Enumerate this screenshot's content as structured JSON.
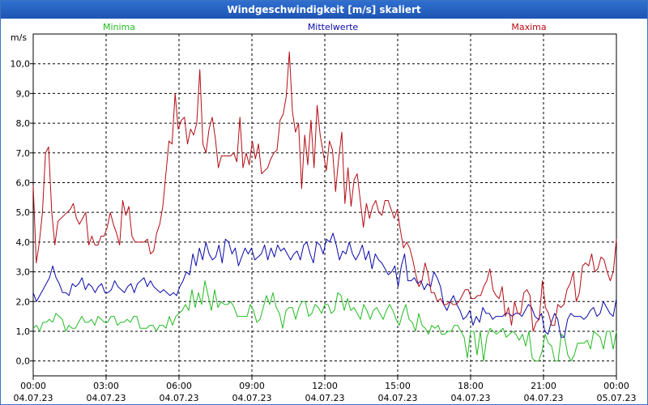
{
  "window": {
    "title": "Windgeschwindigkeit [m/s] skaliert"
  },
  "chart_data": {
    "type": "line",
    "title": "Windgeschwindigkeit [m/s] skaliert",
    "ylabel": "m/s",
    "xlabel": "",
    "ylim": [
      -0.5,
      11.0
    ],
    "xlim": [
      0,
      24
    ],
    "y_ticks": [
      0.0,
      1.0,
      2.0,
      3.0,
      4.0,
      5.0,
      6.0,
      7.0,
      8.0,
      9.0,
      10.0
    ],
    "y_tick_labels": [
      "0,0",
      "1,0",
      "2,0",
      "3,0",
      "4,0",
      "5,0",
      "6,0",
      "7,0",
      "8,0",
      "9,0",
      "10,0"
    ],
    "x_ticks": [
      {
        "x": 0,
        "time": "00:00",
        "date": "04.07.23"
      },
      {
        "x": 3,
        "time": "03:00",
        "date": "04.07.23"
      },
      {
        "x": 6,
        "time": "06:00",
        "date": "04.07.23"
      },
      {
        "x": 9,
        "time": "09:00",
        "date": "04.07.23"
      },
      {
        "x": 12,
        "time": "12:00",
        "date": "04.07.23"
      },
      {
        "x": 15,
        "time": "15:00",
        "date": "04.07.23"
      },
      {
        "x": 18,
        "time": "18:00",
        "date": "04.07.23"
      },
      {
        "x": 21,
        "time": "21:00",
        "date": "04.07.23"
      },
      {
        "x": 24,
        "time": "00:00",
        "date": "05.07.23"
      }
    ],
    "grid": true,
    "legend_position": "top",
    "x_step_hours": 0.16667,
    "series": [
      {
        "name": "Minima",
        "color": "#22bb22",
        "values": [
          1.1,
          1.2,
          1.0,
          1.3,
          1.3,
          1.4,
          1.3,
          1.6,
          1.5,
          1.4,
          1.0,
          1.2,
          1.1,
          1.1,
          1.3,
          1.5,
          1.3,
          1.3,
          1.4,
          1.2,
          1.5,
          1.4,
          1.3,
          1.3,
          1.5,
          1.5,
          1.2,
          1.3,
          1.3,
          1.4,
          1.3,
          1.5,
          1.5,
          1.1,
          1.1,
          1.1,
          1.2,
          1.2,
          1.0,
          1.2,
          1.2,
          1.1,
          1.5,
          1.2,
          1.5,
          1.6,
          1.7,
          1.9,
          1.7,
          2.4,
          1.8,
          2.3,
          1.9,
          2.7,
          2.2,
          1.7,
          2.4,
          1.8,
          2.0,
          1.9,
          1.9,
          2.0,
          1.8,
          1.5,
          1.5,
          1.5,
          1.5,
          1.9,
          1.7,
          1.3,
          1.4,
          1.8,
          2.2,
          1.9,
          2.3,
          1.8,
          1.6,
          1.1,
          1.7,
          1.8,
          1.8,
          1.4,
          1.8,
          2.0,
          2.0,
          1.5,
          1.6,
          1.9,
          1.8,
          1.6,
          1.9,
          1.9,
          1.6,
          1.7,
          2.3,
          2.2,
          1.7,
          2.1,
          1.7,
          1.8,
          1.6,
          1.4,
          1.9,
          1.7,
          1.4,
          1.7,
          1.8,
          1.6,
          1.4,
          1.7,
          1.9,
          1.7,
          1.4,
          1.2,
          1.6,
          1.9,
          1.4,
          1.3,
          1.0,
          1.6,
          1.2,
          1.1,
          0.9,
          1.2,
          1.1,
          1.2,
          0.9,
          0.9,
          1.0,
          1.0,
          1.2,
          1.2,
          1.0,
          0.8,
          0.1,
          1.0,
          1.0,
          0.2,
          1.0,
          0.0,
          0.8,
          1.1,
          1.0,
          0.9,
          1.0,
          1.1,
          0.8,
          0.9,
          1.0,
          0.9,
          0.7,
          0.9,
          0.5,
          1.0,
          0.1,
          0.0,
          0.0,
          0.3,
          0.9,
          0.6,
          0.5,
          0.0,
          0.0,
          0.9,
          0.8,
          0.2,
          0.0,
          0.2,
          0.6,
          0.6,
          0.6,
          0.7,
          0.4,
          1.0,
          0.9,
          0.8,
          0.4,
          1.0,
          1.0,
          0.4,
          1.0
        ]
      },
      {
        "name": "Mittelwerte",
        "color": "#0a0aaa",
        "values": [
          2.3,
          2.0,
          2.2,
          2.4,
          2.6,
          2.8,
          3.2,
          2.8,
          2.6,
          2.3,
          2.3,
          2.2,
          2.6,
          2.5,
          2.6,
          2.8,
          2.4,
          2.6,
          2.5,
          2.3,
          2.5,
          2.6,
          2.3,
          2.3,
          2.4,
          2.7,
          2.5,
          2.4,
          2.3,
          2.5,
          2.6,
          2.3,
          2.6,
          2.7,
          2.8,
          2.5,
          2.7,
          2.5,
          2.4,
          2.3,
          2.4,
          2.3,
          2.2,
          2.3,
          2.2,
          2.5,
          2.7,
          3.0,
          2.9,
          3.6,
          3.2,
          3.8,
          3.4,
          4.0,
          3.6,
          3.4,
          3.5,
          3.9,
          3.3,
          4.1,
          4.0,
          3.6,
          3.8,
          3.2,
          3.5,
          3.8,
          3.6,
          3.8,
          3.4,
          3.5,
          3.6,
          3.9,
          3.4,
          3.8,
          3.5,
          3.9,
          3.7,
          3.8,
          3.6,
          3.4,
          3.6,
          3.7,
          3.4,
          3.9,
          4.0,
          3.6,
          3.3,
          4.0,
          3.9,
          3.6,
          4.1,
          4.0,
          4.3,
          3.9,
          3.4,
          3.7,
          3.6,
          4.0,
          3.6,
          3.4,
          3.6,
          3.9,
          3.4,
          3.7,
          3.1,
          3.6,
          3.4,
          3.3,
          3.1,
          2.9,
          3.0,
          3.2,
          2.5,
          3.2,
          3.6,
          2.7,
          2.7,
          2.8,
          2.6,
          2.7,
          2.4,
          2.6,
          2.5,
          3.0,
          2.8,
          2.5,
          1.9,
          1.7,
          2.0,
          2.2,
          1.9,
          1.7,
          1.4,
          1.5,
          1.7,
          1.2,
          1.5,
          1.3,
          1.8,
          1.6,
          1.6,
          1.4,
          1.5,
          1.5,
          1.5,
          1.6,
          1.6,
          1.5,
          1.6,
          1.6,
          1.5,
          1.7,
          1.9,
          1.8,
          1.5,
          1.4,
          1.6,
          1.0,
          0.9,
          1.3,
          1.6,
          1.4,
          0.8,
          0.8,
          1.4,
          1.6,
          1.5,
          1.5,
          1.5,
          1.4,
          1.5,
          1.7,
          1.8,
          1.5,
          1.6,
          2.0,
          1.8,
          1.6,
          1.5,
          2.1
        ]
      },
      {
        "name": "Maxima",
        "color": "#b40c14",
        "values": [
          5.9,
          3.3,
          4.0,
          5.0,
          7.0,
          7.2,
          5.0,
          3.9,
          4.7,
          4.8,
          4.9,
          5.0,
          5.1,
          5.3,
          4.8,
          4.6,
          4.8,
          5.0,
          3.9,
          4.2,
          3.9,
          3.9,
          4.2,
          4.2,
          4.5,
          5.0,
          4.6,
          4.3,
          3.9,
          5.4,
          4.9,
          5.2,
          4.2,
          4.0,
          4.0,
          4.0,
          4.0,
          4.1,
          3.6,
          3.7,
          4.3,
          4.6,
          5.2,
          6.3,
          7.4,
          7.3,
          9.0,
          7.8,
          8.1,
          8.2,
          7.3,
          7.8,
          7.6,
          8.0,
          9.8,
          7.3,
          7.0,
          7.8,
          8.2,
          7.5,
          6.5,
          6.9,
          6.9,
          6.9,
          6.9,
          7.0,
          6.7,
          8.2,
          6.5,
          7.0,
          6.6,
          7.4,
          6.8,
          7.3,
          6.3,
          6.4,
          6.5,
          6.8,
          7.0,
          7.1,
          8.1,
          8.3,
          8.9,
          10.4,
          8.4,
          7.7,
          8.0,
          5.8,
          7.6,
          6.6,
          8.1,
          6.5,
          8.6,
          7.6,
          7.0,
          6.4,
          7.4,
          7.1,
          5.7,
          6.8,
          7.7,
          5.3,
          6.5,
          5.2,
          6.1,
          6.3,
          5.4,
          4.5,
          5.3,
          4.8,
          5.2,
          5.4,
          5.0,
          4.9,
          5.4,
          5.4,
          5.1,
          4.8,
          5.1,
          4.4,
          3.8,
          4.0,
          3.8,
          3.4,
          2.9,
          2.5,
          2.7,
          3.3,
          2.9,
          2.3,
          2.3,
          2.0,
          2.1,
          1.9,
          1.9,
          2.0,
          1.9,
          1.9,
          2.0,
          2.2,
          2.4,
          2.4,
          2.1,
          2.1,
          2.2,
          2.2,
          2.5,
          2.7,
          3.1,
          2.4,
          2.2,
          2.1,
          2.5,
          1.5,
          1.8,
          1.2,
          2.0,
          1.6,
          1.6,
          2.3,
          2.4,
          2.2,
          1.0,
          1.3,
          1.4,
          2.7,
          1.8,
          1.6,
          1.2,
          1.2,
          1.9,
          1.8,
          1.9,
          2.4,
          2.6,
          3.0,
          2.0,
          2.3,
          3.2,
          3.3,
          3.2,
          3.6,
          3.0,
          3.1,
          3.5,
          3.4,
          3.0,
          2.7,
          3.0,
          4.1
        ]
      }
    ]
  }
}
